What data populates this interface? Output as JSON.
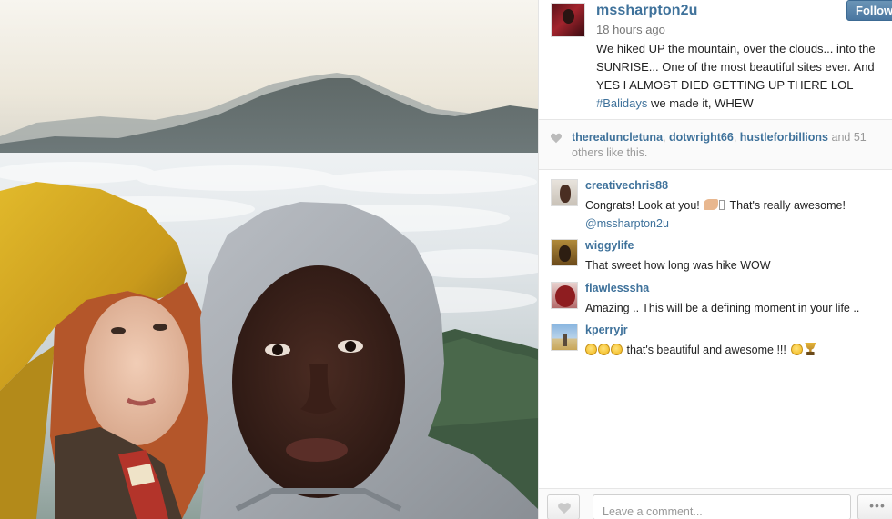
{
  "post": {
    "username": "mssharpton2u",
    "time_ago": "18 hours ago",
    "caption_text": "We hiked UP the mountain, over the clouds... into the SUNRISE... One of the most beautiful sites ever. And YES I ALMOST DIED GETTING UP THERE LOL",
    "caption_hashtag": "#Balidays",
    "caption_tail": " we made it, WHEW",
    "follow_label": "Follow"
  },
  "likes": {
    "user1": "therealuncletuna",
    "sep1": ", ",
    "user2": "dotwright66",
    "sep2": ", ",
    "user3": "hustleforbillions",
    "tail": " and 51 others like this."
  },
  "comments": [
    {
      "user": "creativechris88",
      "text_before": "Congrats! Look at you! ",
      "text_after": " That's really awesome!",
      "mention": "@mssharpton2u"
    },
    {
      "user": "wiggylife",
      "text": "That sweet how long was hike WOW"
    },
    {
      "user": "flawlesssha",
      "text": "Amazing .. This will be a defining moment in your life .."
    },
    {
      "user": "kperryjr",
      "text": " that's beautiful and awesome !!! "
    }
  ],
  "input": {
    "placeholder": "Leave a comment...",
    "more_label": "•••"
  },
  "colors": {
    "link_blue": "#3f729b",
    "follow_button": "#517fa4"
  },
  "icons": {
    "like": "heart-icon",
    "likes_count": "heart-small-icon",
    "more": "ellipsis-icon"
  }
}
